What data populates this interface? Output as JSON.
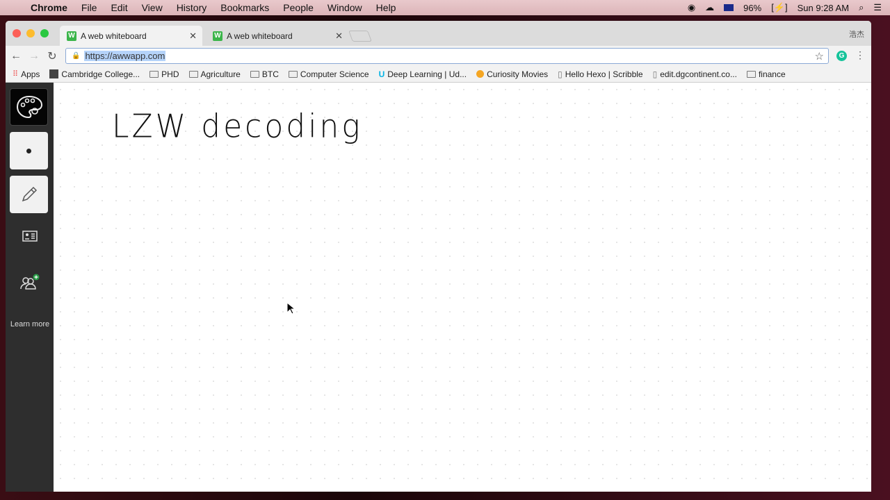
{
  "menubar": {
    "app": "Chrome",
    "items": [
      "File",
      "Edit",
      "View",
      "History",
      "Bookmarks",
      "People",
      "Window",
      "Help"
    ],
    "battery": "96%",
    "clock": "Sun 9:28 AM"
  },
  "tabs": [
    {
      "title": "A web whiteboard",
      "active": true
    },
    {
      "title": "A web whiteboard",
      "active": false
    }
  ],
  "profile": "浩杰",
  "omnibox": {
    "url": "https://awwapp.com"
  },
  "bookmarks": [
    {
      "label": "Apps",
      "icon": "apps-grid-icon"
    },
    {
      "label": "Cambridge College...",
      "icon": "site-icon"
    },
    {
      "label": "PHD",
      "icon": "folder-icon"
    },
    {
      "label": "Agriculture",
      "icon": "folder-icon"
    },
    {
      "label": "BTC",
      "icon": "folder-icon"
    },
    {
      "label": "Computer Science",
      "icon": "folder-icon"
    },
    {
      "label": "Deep Learning | Ud...",
      "icon": "udacity-icon"
    },
    {
      "label": "Curiosity Movies",
      "icon": "curiosity-icon"
    },
    {
      "label": "Hello Hexo | Scribble",
      "icon": "page-icon"
    },
    {
      "label": "edit.dgcontinent.co...",
      "icon": "page-icon"
    },
    {
      "label": "finance",
      "icon": "folder-icon"
    }
  ],
  "sidebar": {
    "learn_more": "Learn more"
  },
  "canvas": {
    "handwriting": "LZW decoding"
  },
  "colors": {
    "accent": "#3bb54a",
    "sidebar": "#2e2e2e"
  }
}
